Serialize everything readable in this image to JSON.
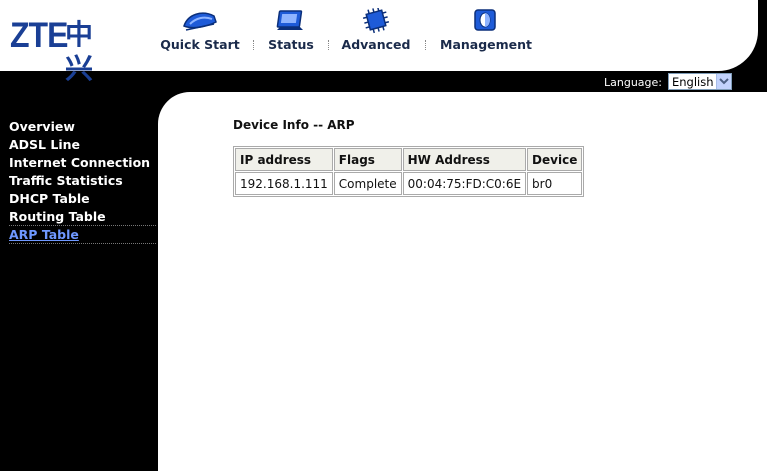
{
  "brand": {
    "logo_latin": "ZTE",
    "logo_cjk": "中兴",
    "color": "#1a3f95"
  },
  "nav": {
    "items": [
      {
        "label": "Quick Start",
        "icon": "quick-start-icon"
      },
      {
        "label": "Status",
        "icon": "status-monitor-icon"
      },
      {
        "label": "Advanced",
        "icon": "chip-icon"
      },
      {
        "label": "Management",
        "icon": "management-icon"
      }
    ]
  },
  "language": {
    "label": "Language:",
    "selected": "English"
  },
  "sidebar": {
    "items": [
      {
        "label": "Overview"
      },
      {
        "label": "ADSL Line"
      },
      {
        "label": "Internet Connection"
      },
      {
        "label": "Traffic Statistics"
      },
      {
        "label": "DHCP Table"
      },
      {
        "label": "Routing Table"
      },
      {
        "label": "ARP Table",
        "active": true
      }
    ],
    "active_color": "#6f98ff"
  },
  "main": {
    "title": "Device Info -- ARP",
    "table": {
      "headers": [
        "IP address",
        "Flags",
        "HW Address",
        "Device"
      ],
      "rows": [
        [
          "192.168.1.111",
          "Complete",
          "00:04:75:FD:C0:6E",
          "br0"
        ]
      ]
    }
  }
}
